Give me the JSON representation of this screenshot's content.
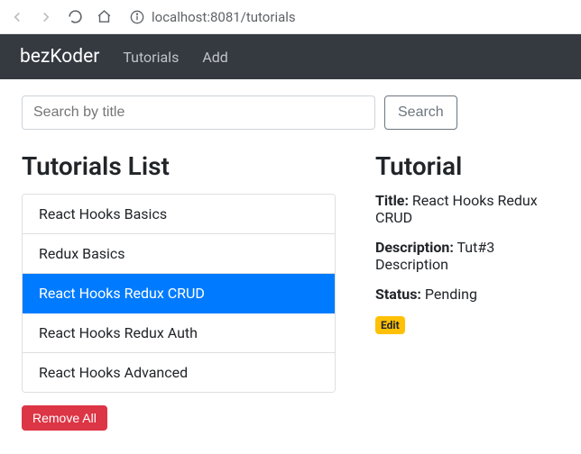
{
  "browser": {
    "url": "localhost:8081/tutorials"
  },
  "navbar": {
    "brand": "bezKoder",
    "links": [
      "Tutorials",
      "Add"
    ]
  },
  "search": {
    "placeholder": "Search by title",
    "button": "Search"
  },
  "list": {
    "title": "Tutorials List",
    "items": [
      {
        "label": "React Hooks Basics",
        "active": false
      },
      {
        "label": "Redux Basics",
        "active": false
      },
      {
        "label": "React Hooks Redux CRUD",
        "active": true
      },
      {
        "label": "React Hooks Redux Auth",
        "active": false
      },
      {
        "label": "React Hooks Advanced",
        "active": false
      }
    ],
    "remove_all": "Remove All"
  },
  "detail": {
    "heading": "Tutorial",
    "title_label": "Title:",
    "title_value": "React Hooks Redux CRUD",
    "description_label": "Description:",
    "description_value": "Tut#3 Description",
    "status_label": "Status:",
    "status_value": "Pending",
    "edit": "Edit"
  }
}
